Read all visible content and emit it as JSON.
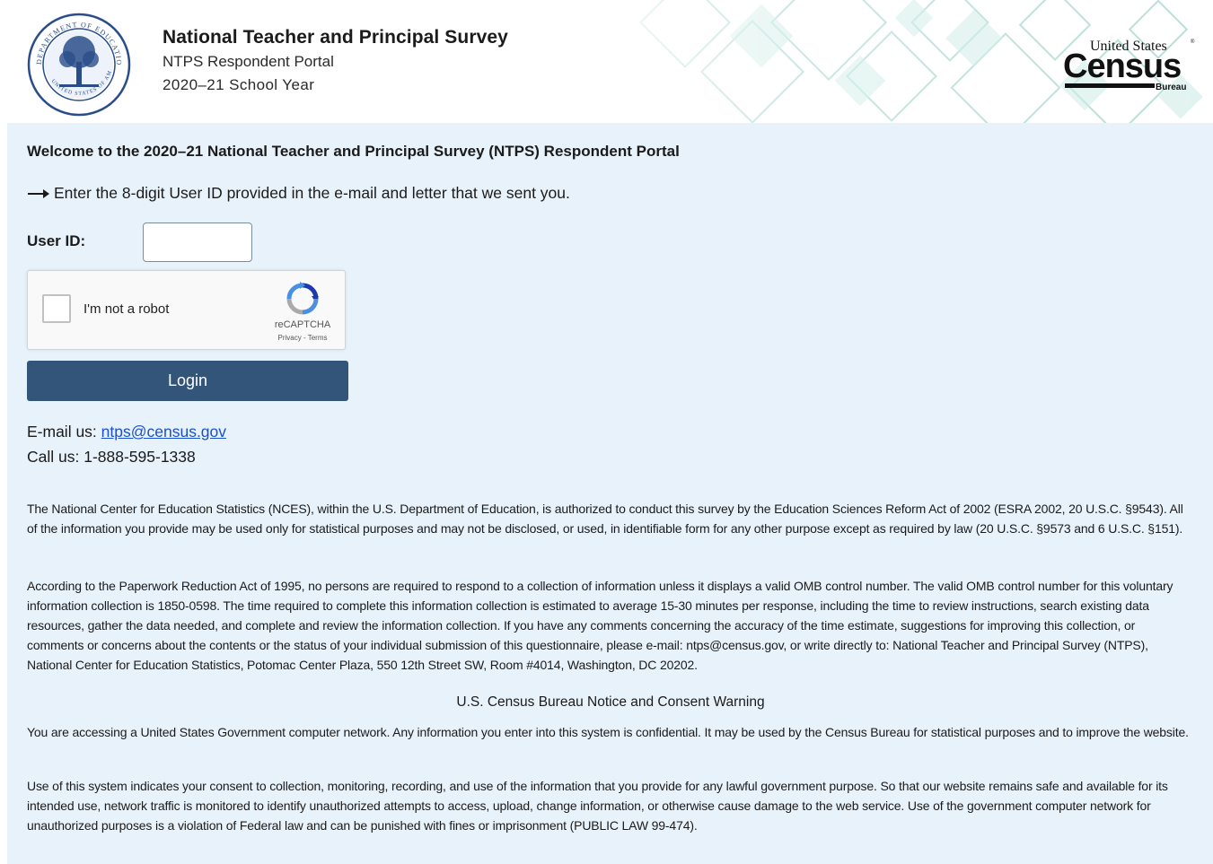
{
  "header": {
    "title": "National Teacher and Principal Survey",
    "subtitle": "NTPS Respondent Portal",
    "school_year": "2020–21 School Year",
    "seal_icon": "department-of-education-seal-icon",
    "census_logo": {
      "top_text": "United States",
      "main_text": "Census",
      "bottom_text": "Bureau"
    }
  },
  "main": {
    "welcome": "Welcome to the 2020–21 National Teacher and Principal Survey (NTPS) Respondent Portal",
    "instruction": "Enter the 8-digit User ID provided in the e-mail and letter that we sent you.",
    "user_id_label": "User ID:",
    "user_id_value": "",
    "recaptcha": {
      "label": "I'm not a robot",
      "brand": "reCAPTCHA",
      "links": "Privacy - Terms"
    },
    "login_label": "Login",
    "email_prefix": "E-mail us: ",
    "email_link": "ntps@census.gov",
    "phone": "Call us: 1-888-595-1338"
  },
  "legal": {
    "nces": "The National Center for Education Statistics (NCES), within the U.S. Department of Education, is authorized to conduct this survey by the Education Sciences Reform Act of 2002 (ESRA 2002, 20 U.S.C. §9543). All of the information you provide may be used only for statistical purposes and may not be disclosed, or used, in identifiable form for any other purpose except as required by law (20 U.S.C. §9573 and 6 U.S.C. §151).",
    "paperwork": "According to the Paperwork Reduction Act of 1995, no persons are required to respond to a collection of information unless it displays a valid OMB control number. The valid OMB control number for this voluntary information collection is 1850-0598. The time required to complete this information collection is estimated to average 15-30 minutes per response, including the time to review instructions, search existing data resources, gather the data needed, and complete and review the information collection. If you have any comments concerning the accuracy of the time estimate, suggestions for improving this collection, or comments or concerns about the contents or the status of your individual submission of this questionnaire, please e-mail: ntps@census.gov, or write directly to: National Teacher and Principal Survey (NTPS), National Center for Education Statistics, Potomac Center Plaza, 550 12th Street SW, Room #4014, Washington, DC 20202.",
    "notice_title": "U.S. Census Bureau Notice and Consent Warning",
    "notice_1": "You are accessing a United States Government computer network. Any information you enter into this system is confidential. It may be used by the Census Bureau for statistical purposes and to improve the website.",
    "notice_2": "Use of this system indicates your consent to collection, monitoring, recording, and use of the information that you provide for any lawful government purpose. So that our website remains safe and available for its intended use, network traffic is monitored to identify unauthorized attempts to access, upload, change information, or otherwise cause damage to the web service. Use of the government computer network for unauthorized purposes is a violation of Federal law and can be punished with fines or imprisonment (PUBLIC LAW 99-474)."
  },
  "colors": {
    "panel_bg": "#e8f2fa",
    "login_button": "#33557a",
    "link": "#1a4fd0",
    "pattern": "#a8d8d0"
  }
}
